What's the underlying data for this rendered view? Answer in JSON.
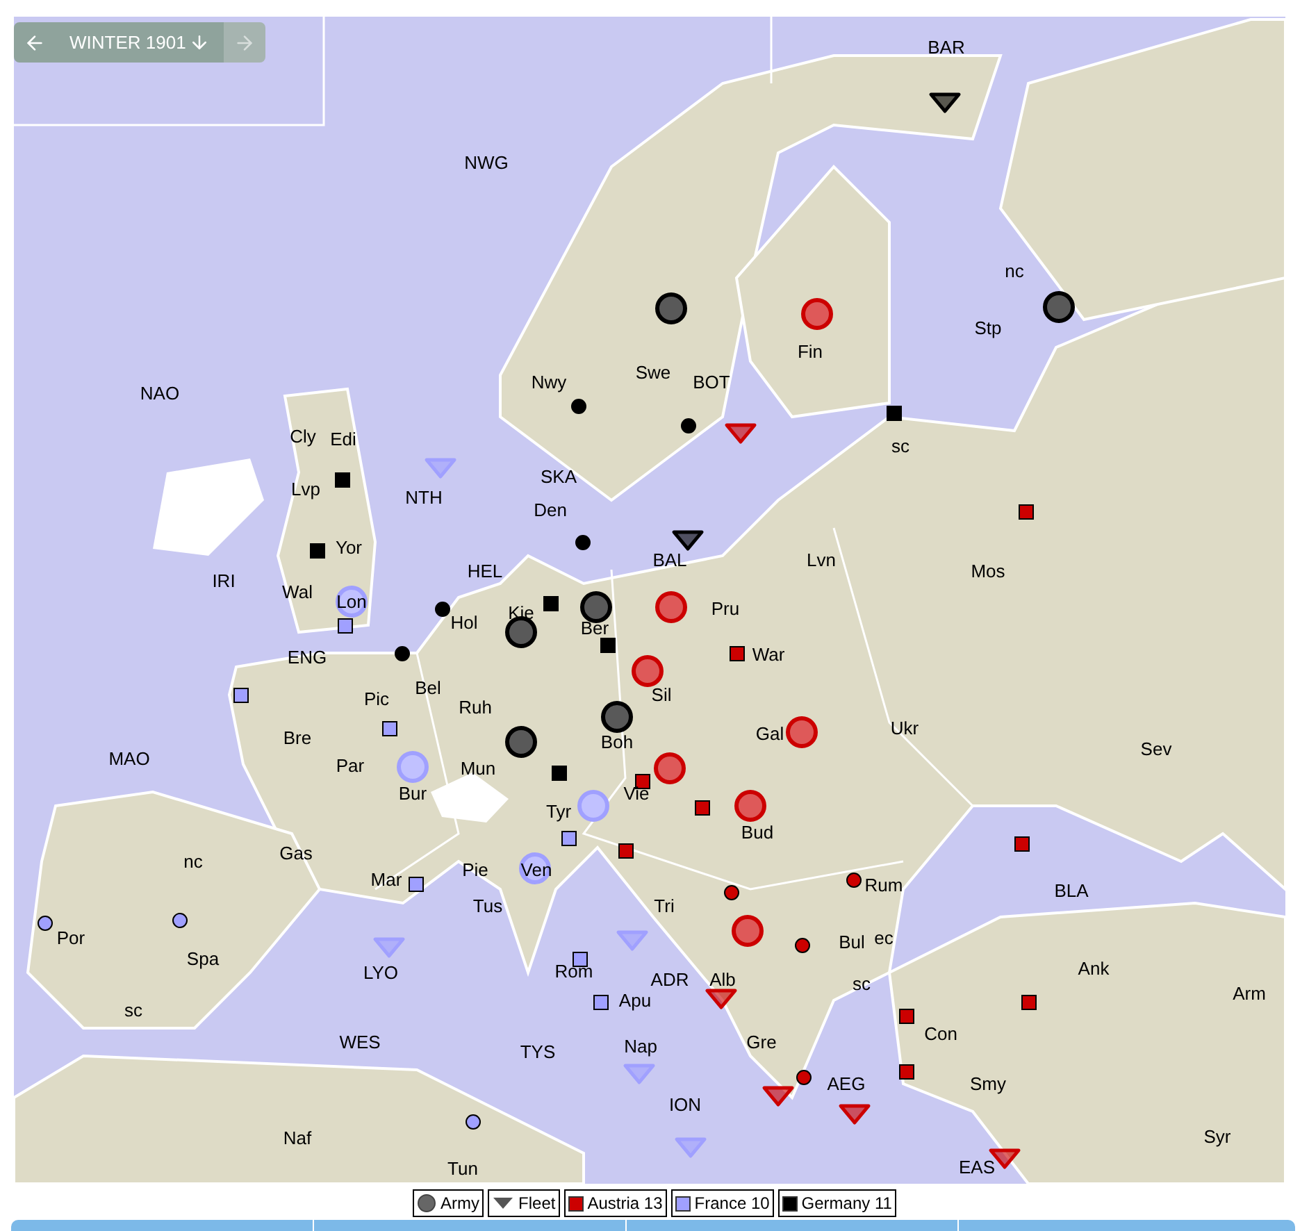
{
  "nav": {
    "label": "WINTER 1901",
    "previous_disabled": false,
    "next_disabled": true
  },
  "map": {
    "regions": [
      {
        "label": "BAR"
      },
      {
        "label": "NWG"
      },
      {
        "label": "NAO"
      },
      {
        "label": "Nwy"
      },
      {
        "label": "Swe"
      },
      {
        "label": "BOT"
      },
      {
        "label": "Fin"
      },
      {
        "label": "nc"
      },
      {
        "label": "Stp"
      },
      {
        "label": "sc"
      },
      {
        "label": "Cly"
      },
      {
        "label": "Edi"
      },
      {
        "label": "Lvp"
      },
      {
        "label": "NTH"
      },
      {
        "label": "SKA"
      },
      {
        "label": "Den"
      },
      {
        "label": "IRI"
      },
      {
        "label": "Yor"
      },
      {
        "label": "Wal"
      },
      {
        "label": "Lon"
      },
      {
        "label": "HEL"
      },
      {
        "label": "BAL"
      },
      {
        "label": "Lvn"
      },
      {
        "label": "Mos"
      },
      {
        "label": "Kie"
      },
      {
        "label": "Ber"
      },
      {
        "label": "Hol"
      },
      {
        "label": "Pru"
      },
      {
        "label": "ENG"
      },
      {
        "label": "War"
      },
      {
        "label": "Bel"
      },
      {
        "label": "Pic"
      },
      {
        "label": "Ruh"
      },
      {
        "label": "Sil"
      },
      {
        "label": "Bre"
      },
      {
        "label": "Ukr"
      },
      {
        "label": "Sev"
      },
      {
        "label": "MAO"
      },
      {
        "label": "Par"
      },
      {
        "label": "Gal"
      },
      {
        "label": "Boh"
      },
      {
        "label": "Bur"
      },
      {
        "label": "Mun"
      },
      {
        "label": "Tyr"
      },
      {
        "label": "Vie"
      },
      {
        "label": "Bud"
      },
      {
        "label": "Gas"
      },
      {
        "label": "nc"
      },
      {
        "label": "Mar"
      },
      {
        "label": "Pie"
      },
      {
        "label": "Ven"
      },
      {
        "label": "Rum"
      },
      {
        "label": "BLA"
      },
      {
        "label": "Tri"
      },
      {
        "label": "Tus"
      },
      {
        "label": "Por"
      },
      {
        "label": "Spa"
      },
      {
        "label": "Bul"
      },
      {
        "label": "ec"
      },
      {
        "label": "LYO"
      },
      {
        "label": "Rom"
      },
      {
        "label": "ADR"
      },
      {
        "label": "Alb"
      },
      {
        "label": "sc"
      },
      {
        "label": "Ank"
      },
      {
        "label": "sc"
      },
      {
        "label": "Apu"
      },
      {
        "label": "Arm"
      },
      {
        "label": "WES"
      },
      {
        "label": "TYS"
      },
      {
        "label": "Nap"
      },
      {
        "label": "Gre"
      },
      {
        "label": "Con"
      },
      {
        "label": "AEG"
      },
      {
        "label": "Smy"
      },
      {
        "label": "ION"
      },
      {
        "label": "Naf"
      },
      {
        "label": "Syr"
      },
      {
        "label": "EAS"
      },
      {
        "label": "Tun"
      }
    ],
    "supply_centers": [
      {
        "kind": "square",
        "color": "#000000"
      },
      {
        "kind": "square",
        "color": "#000000"
      },
      {
        "kind": "square",
        "color": "#000000"
      },
      {
        "kind": "square",
        "color": "#000000"
      },
      {
        "kind": "square",
        "color": "#000000"
      },
      {
        "kind": "square",
        "color": "#000000"
      },
      {
        "kind": "circle",
        "color": "#000000"
      },
      {
        "kind": "circle",
        "color": "#000000"
      },
      {
        "kind": "circle",
        "color": "#000000"
      },
      {
        "kind": "circle",
        "color": "#000000"
      },
      {
        "kind": "circle",
        "color": "#000000"
      },
      {
        "kind": "square",
        "color": "#cc0000"
      },
      {
        "kind": "square",
        "color": "#cc0000"
      },
      {
        "kind": "square",
        "color": "#cc0000"
      },
      {
        "kind": "square",
        "color": "#cc0000"
      },
      {
        "kind": "square",
        "color": "#cc0000"
      },
      {
        "kind": "square",
        "color": "#cc0000"
      },
      {
        "kind": "square",
        "color": "#cc0000"
      },
      {
        "kind": "square",
        "color": "#cc0000"
      },
      {
        "kind": "square",
        "color": "#cc0000"
      },
      {
        "kind": "circle",
        "color": "#cc0000"
      },
      {
        "kind": "circle",
        "color": "#cc0000"
      },
      {
        "kind": "circle",
        "color": "#cc0000"
      },
      {
        "kind": "circle",
        "color": "#cc0000"
      },
      {
        "kind": "square",
        "color": "#a0a0ff"
      },
      {
        "kind": "square",
        "color": "#a0a0ff"
      },
      {
        "kind": "square",
        "color": "#a0a0ff"
      },
      {
        "kind": "square",
        "color": "#a0a0ff"
      },
      {
        "kind": "square",
        "color": "#a0a0ff"
      },
      {
        "kind": "square",
        "color": "#a0a0ff"
      },
      {
        "kind": "square",
        "color": "#a0a0ff"
      },
      {
        "kind": "circle",
        "color": "#a0a0ff"
      },
      {
        "kind": "circle",
        "color": "#a0a0ff"
      },
      {
        "kind": "circle",
        "color": "#a0a0ff"
      }
    ],
    "units": [
      {
        "kind": "army",
        "color": "#000000"
      },
      {
        "kind": "army",
        "color": "#000000"
      },
      {
        "kind": "fleet",
        "color": "#000000"
      },
      {
        "kind": "fleet",
        "color": "#000000"
      },
      {
        "kind": "army",
        "color": "#000000"
      },
      {
        "kind": "army",
        "color": "#000000"
      },
      {
        "kind": "army",
        "color": "#000000"
      },
      {
        "kind": "army",
        "color": "#000000"
      },
      {
        "kind": "army",
        "color": "#cc0000"
      },
      {
        "kind": "fleet",
        "color": "#cc0000"
      },
      {
        "kind": "army",
        "color": "#cc0000"
      },
      {
        "kind": "army",
        "color": "#cc0000"
      },
      {
        "kind": "army",
        "color": "#cc0000"
      },
      {
        "kind": "army",
        "color": "#cc0000"
      },
      {
        "kind": "army",
        "color": "#cc0000"
      },
      {
        "kind": "army",
        "color": "#cc0000"
      },
      {
        "kind": "fleet",
        "color": "#cc0000"
      },
      {
        "kind": "fleet",
        "color": "#cc0000"
      },
      {
        "kind": "fleet",
        "color": "#cc0000"
      },
      {
        "kind": "fleet",
        "color": "#cc0000"
      },
      {
        "kind": "fleet",
        "color": "#a0a0ff"
      },
      {
        "kind": "army",
        "color": "#a0a0ff"
      },
      {
        "kind": "army",
        "color": "#a0a0ff"
      },
      {
        "kind": "army",
        "color": "#a0a0ff"
      },
      {
        "kind": "army",
        "color": "#a0a0ff"
      },
      {
        "kind": "fleet",
        "color": "#a0a0ff"
      },
      {
        "kind": "fleet",
        "color": "#a0a0ff"
      },
      {
        "kind": "fleet",
        "color": "#a0a0ff"
      },
      {
        "kind": "fleet",
        "color": "#a0a0ff"
      }
    ]
  },
  "legend": [
    {
      "kind": "army",
      "label": "Army"
    },
    {
      "kind": "fleet",
      "label": "Fleet"
    },
    {
      "kind": "country",
      "label": "Austria 13",
      "color": "#cc0000"
    },
    {
      "kind": "country",
      "label": "France 10",
      "color": "#a0a0ff"
    },
    {
      "kind": "country",
      "label": "Germany 11",
      "color": "#000000"
    }
  ]
}
